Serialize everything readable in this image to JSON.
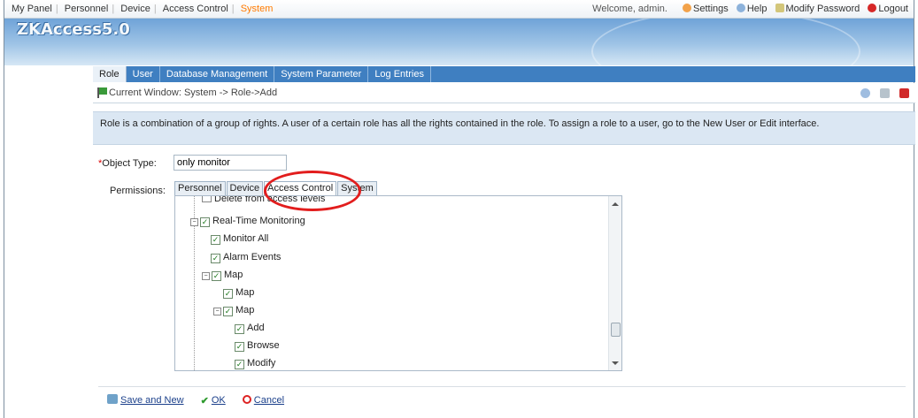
{
  "topnav": {
    "items": [
      "My Panel",
      "Personnel",
      "Device",
      "Access Control",
      "System"
    ],
    "active": "System"
  },
  "userbar": {
    "welcome": "Welcome, admin.",
    "settings": "Settings",
    "help": "Help",
    "modify_password": "Modify Password",
    "logout": "Logout"
  },
  "brand": {
    "logo": "ZKAccess5.0"
  },
  "tabs": [
    "Role",
    "User",
    "Database Management",
    "System Parameter",
    "Log Entries"
  ],
  "current_window": "Current Window: System -> Role->Add",
  "info": "Role is a combination of a group of rights. A user of a certain role has all the rights contained in the role. To assign a role to a user, go to the New User or Edit interface.",
  "form": {
    "object_type_label": "Object Type:",
    "object_type_value": "only monitor",
    "permissions_label": "Permissions:"
  },
  "permission_tabs": [
    "Personnel",
    "Device",
    "Access Control",
    "System"
  ],
  "tree": {
    "delete_from_access_levels": "Delete from access levels",
    "real_time_monitoring": "Real-Time Monitoring",
    "monitor_all": "Monitor All",
    "alarm_events": "Alarm Events",
    "map_1": "Map",
    "map_2": "Map",
    "map_3": "Map",
    "add": "Add",
    "browse": "Browse",
    "modify": "Modify"
  },
  "actions": {
    "save_and_new": "Save and New",
    "ok": "OK",
    "cancel": "Cancel"
  },
  "colors": {
    "tab_bar": "#3f7fc1",
    "active_nav": "#ff7a00",
    "highlight_circle": "#e21d1d",
    "info_bg": "#dbe7f3"
  }
}
